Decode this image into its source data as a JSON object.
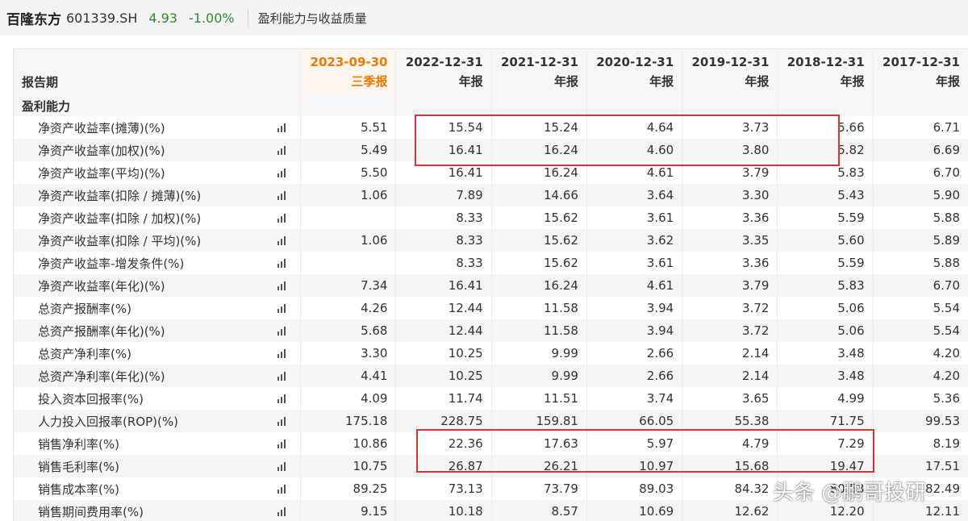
{
  "header": {
    "stock_name": "百隆东方",
    "stock_code": "601339.SH",
    "price": "4.93",
    "change": "-1.00%",
    "section_title": "盈利能力与收益质量"
  },
  "table": {
    "period_label": "报告期",
    "group_label": "盈利能力",
    "columns": [
      {
        "date": "2023-09-30",
        "type": "三季报"
      },
      {
        "date": "2022-12-31",
        "type": "年报"
      },
      {
        "date": "2021-12-31",
        "type": "年报"
      },
      {
        "date": "2020-12-31",
        "type": "年报"
      },
      {
        "date": "2019-12-31",
        "type": "年报"
      },
      {
        "date": "2018-12-31",
        "type": "年报"
      },
      {
        "date": "2017-12-31",
        "type": "年报"
      }
    ],
    "rows": [
      {
        "label": "净资产收益率(摊薄)(%)",
        "values": [
          "5.51",
          "15.54",
          "15.24",
          "4.64",
          "3.73",
          "5.66",
          "6.71"
        ]
      },
      {
        "label": "净资产收益率(加权)(%)",
        "values": [
          "5.49",
          "16.41",
          "16.24",
          "4.60",
          "3.80",
          "5.82",
          "6.69"
        ]
      },
      {
        "label": "净资产收益率(平均)(%)",
        "values": [
          "5.50",
          "16.41",
          "16.24",
          "4.61",
          "3.79",
          "5.83",
          "6.70"
        ]
      },
      {
        "label": "净资产收益率(扣除 / 摊薄)(%)",
        "values": [
          "1.06",
          "7.89",
          "14.66",
          "3.64",
          "3.30",
          "5.43",
          "5.90"
        ]
      },
      {
        "label": "净资产收益率(扣除 / 加权)(%)",
        "values": [
          "",
          "8.33",
          "15.62",
          "3.61",
          "3.36",
          "5.59",
          "5.88"
        ]
      },
      {
        "label": "净资产收益率(扣除 / 平均)(%)",
        "values": [
          "1.06",
          "8.33",
          "15.62",
          "3.62",
          "3.35",
          "5.60",
          "5.89"
        ]
      },
      {
        "label": "净资产收益率-增发条件(%)",
        "values": [
          "",
          "8.33",
          "15.62",
          "3.61",
          "3.36",
          "5.59",
          "5.88"
        ]
      },
      {
        "label": "净资产收益率(年化)(%)",
        "values": [
          "7.34",
          "16.41",
          "16.24",
          "4.61",
          "3.79",
          "5.83",
          "6.70"
        ]
      },
      {
        "label": "总资产报酬率(%)",
        "values": [
          "4.26",
          "12.44",
          "11.58",
          "3.94",
          "3.72",
          "5.06",
          "5.54"
        ]
      },
      {
        "label": "总资产报酬率(年化)(%)",
        "values": [
          "5.68",
          "12.44",
          "11.58",
          "3.94",
          "3.72",
          "5.06",
          "5.54"
        ]
      },
      {
        "label": "总资产净利率(%)",
        "values": [
          "3.30",
          "10.25",
          "9.99",
          "2.66",
          "2.14",
          "3.48",
          "4.20"
        ]
      },
      {
        "label": "总资产净利率(年化)(%)",
        "values": [
          "4.41",
          "10.25",
          "9.99",
          "2.66",
          "2.14",
          "3.48",
          "4.20"
        ]
      },
      {
        "label": "投入资本回报率(%)",
        "values": [
          "4.09",
          "11.74",
          "11.51",
          "3.74",
          "3.65",
          "4.99",
          "5.36"
        ]
      },
      {
        "label": "人力投入回报率(ROP)(%)",
        "values": [
          "175.18",
          "228.75",
          "159.81",
          "66.05",
          "55.38",
          "71.75",
          "99.53"
        ]
      },
      {
        "label": "销售净利率(%)",
        "values": [
          "10.86",
          "22.36",
          "17.63",
          "5.97",
          "4.79",
          "7.29",
          "8.19"
        ]
      },
      {
        "label": "销售毛利率(%)",
        "values": [
          "10.75",
          "26.87",
          "26.21",
          "10.97",
          "15.68",
          "19.47",
          "17.51"
        ]
      },
      {
        "label": "销售成本率(%)",
        "values": [
          "89.25",
          "73.13",
          "73.79",
          "89.03",
          "84.32",
          "80.53",
          "82.49"
        ]
      },
      {
        "label": "销售期间费用率(%)",
        "values": [
          "9.15",
          "10.18",
          "8.57",
          "10.69",
          "12.62",
          "12.20",
          "12.11"
        ]
      }
    ]
  },
  "watermark": "头条 @鹏哥投研",
  "colors": {
    "current_period": "#f07800",
    "price_down": "#2e8b2e",
    "highlight_box": "#e33030"
  },
  "icons": {
    "row_chart": "bar-chart-icon"
  }
}
